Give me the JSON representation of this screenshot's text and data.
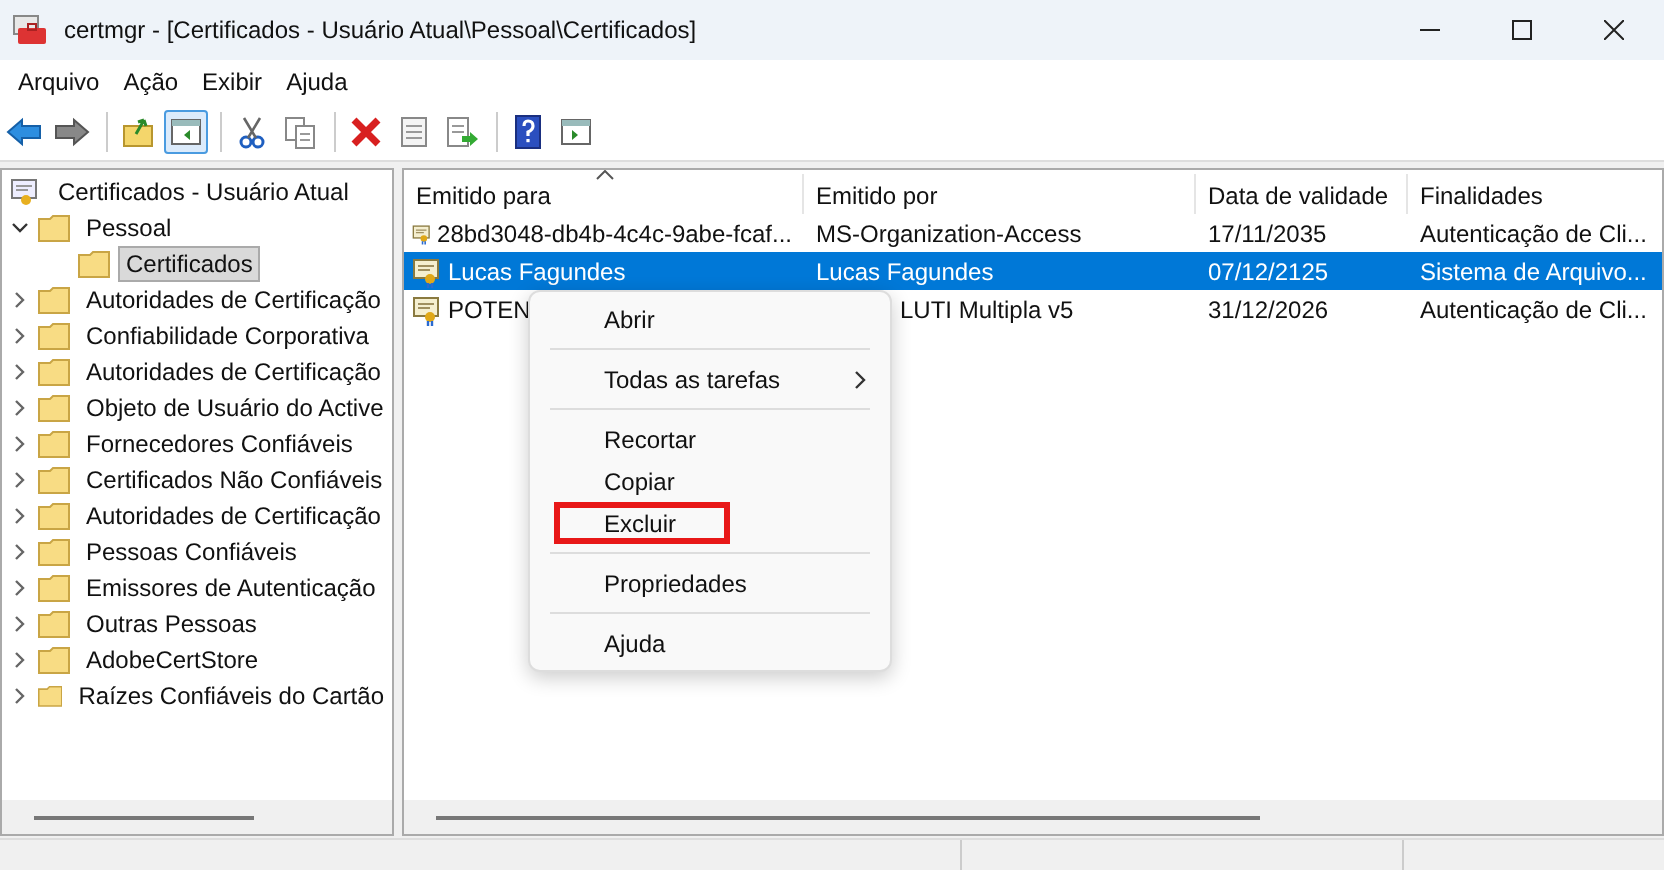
{
  "window": {
    "title": "certmgr - [Certificados - Usuário Atual\\Pessoal\\Certificados]"
  },
  "menu": [
    "Arquivo",
    "Ação",
    "Exibir",
    "Ajuda"
  ],
  "toolbar": [
    {
      "kind": "back",
      "pressed": false
    },
    {
      "kind": "forward",
      "pressed": false
    },
    {
      "kind": "sep"
    },
    {
      "kind": "up",
      "pressed": false
    },
    {
      "kind": "tree",
      "pressed": true
    },
    {
      "kind": "sep"
    },
    {
      "kind": "cut",
      "pressed": false
    },
    {
      "kind": "copy",
      "pressed": false
    },
    {
      "kind": "sep"
    },
    {
      "kind": "delete",
      "pressed": false
    },
    {
      "kind": "properties",
      "pressed": false
    },
    {
      "kind": "export",
      "pressed": false
    },
    {
      "kind": "sep"
    },
    {
      "kind": "help",
      "pressed": false
    },
    {
      "kind": "console",
      "pressed": false
    }
  ],
  "tree": {
    "label": "Certificados - Usuário Atual",
    "selected": false,
    "children": [
      {
        "label": "Pessoal",
        "expanded": true,
        "selected": false,
        "children": [
          {
            "label": "Certificados",
            "selected": true
          }
        ]
      },
      {
        "label": "Autoridades de Certificação",
        "expanded": false,
        "selected": false
      },
      {
        "label": "Confiabilidade Corporativa",
        "expanded": false,
        "selected": false
      },
      {
        "label": "Autoridades de Certificação",
        "expanded": false,
        "selected": false
      },
      {
        "label": "Objeto de Usuário do Active",
        "expanded": false,
        "selected": false
      },
      {
        "label": "Fornecedores Confiáveis",
        "expanded": false,
        "selected": false
      },
      {
        "label": "Certificados Não Confiáveis",
        "expanded": false,
        "selected": false
      },
      {
        "label": "Autoridades de Certificação",
        "expanded": false,
        "selected": false
      },
      {
        "label": "Pessoas Confiáveis",
        "expanded": false,
        "selected": false
      },
      {
        "label": "Emissores de Autenticação",
        "expanded": false,
        "selected": false
      },
      {
        "label": "Outras Pessoas",
        "expanded": false,
        "selected": false
      },
      {
        "label": "AdobeCertStore",
        "expanded": false,
        "selected": false
      },
      {
        "label": "Raízes Confiáveis do Cartão",
        "expanded": false,
        "selected": false
      }
    ]
  },
  "table": {
    "columns": [
      "Emitido para",
      "Emitido por",
      "Data de validade",
      "Finalidades"
    ],
    "rows": [
      {
        "selected": false,
        "cells": [
          "28bd3048-db4b-4c4c-9abe-fcaf...",
          "MS-Organization-Access",
          "17/11/2035",
          "Autenticação de Cli..."
        ]
      },
      {
        "selected": true,
        "cells": [
          "Lucas Fagundes",
          "Lucas Fagundes",
          "07/12/2125",
          "Sistema de Arquivo..."
        ]
      },
      {
        "selected": false,
        "cells": [
          "POTEN",
          "LUTI Multipla v5",
          "31/12/2026",
          "Autenticação de Cli..."
        ]
      }
    ]
  },
  "context_menu": {
    "items": [
      {
        "kind": "item",
        "label": "Abrir",
        "highlighted": false
      },
      {
        "kind": "sep"
      },
      {
        "kind": "submenu",
        "label": "Todas as tarefas",
        "highlighted": false
      },
      {
        "kind": "sep"
      },
      {
        "kind": "item",
        "label": "Recortar",
        "highlighted": false
      },
      {
        "kind": "item",
        "label": "Copiar",
        "highlighted": false
      },
      {
        "kind": "item",
        "label": "Excluir",
        "highlighted": true
      },
      {
        "kind": "sep"
      },
      {
        "kind": "item",
        "label": "Propriedades",
        "highlighted": false
      },
      {
        "kind": "sep"
      },
      {
        "kind": "item",
        "label": "Ajuda",
        "highlighted": false
      }
    ]
  }
}
